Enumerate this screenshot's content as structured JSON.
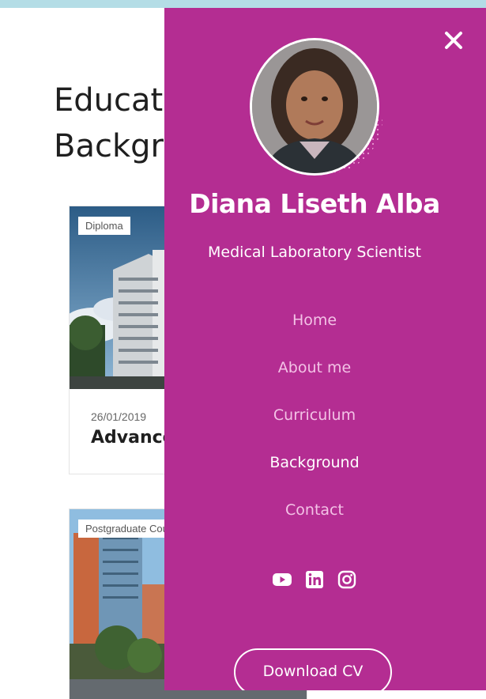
{
  "page": {
    "section_title": "Educational\nBackground"
  },
  "cards": [
    {
      "badge": "Diploma",
      "date": "26/01/2019",
      "title": "Advanced"
    },
    {
      "badge": "Postgraduate Course",
      "date": "",
      "title": ""
    }
  ],
  "menu": {
    "name": "Diana Liseth Alba",
    "role": "Medical Laboratory Scientist",
    "items": [
      {
        "label": "Home",
        "active": false
      },
      {
        "label": "About me",
        "active": false
      },
      {
        "label": "Curriculum",
        "active": false
      },
      {
        "label": "Background",
        "active": true
      },
      {
        "label": "Contact",
        "active": false
      }
    ],
    "social_icons": [
      "youtube-icon",
      "linkedin-icon",
      "instagram-icon"
    ],
    "download_label": "Download CV",
    "colors": {
      "panel": "#b42d92",
      "nav_inactive": "#f3c2e6",
      "nav_active": "#ffffff",
      "top_strip": "#b4dde6"
    }
  }
}
